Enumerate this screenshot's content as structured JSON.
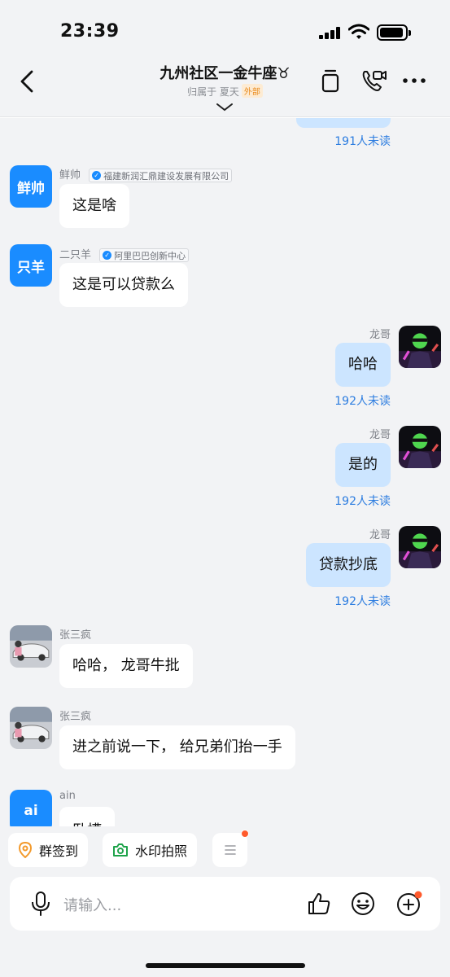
{
  "status_bar": {
    "time": "23:39"
  },
  "header": {
    "title": "九州社区一金牛座♉",
    "subtitle_prefix": "归属于 夏天",
    "subtitle_tag": "外部",
    "icons": [
      "back-icon",
      "copy-icon",
      "video-call-icon",
      "more-icon",
      "chevron-down-icon"
    ]
  },
  "messages": [
    {
      "kind": "out_partial",
      "unread": "191人未读"
    },
    {
      "kind": "in",
      "avatar_text": "鲜帅",
      "sender": "鲜帅",
      "org": "福建新润汇鼎建设发展有限公司",
      "text": "这是啥"
    },
    {
      "kind": "in",
      "avatar_text": "只羊",
      "sender": "二只羊",
      "org": "阿里巴巴创新中心",
      "text": "这是可以贷款么"
    },
    {
      "kind": "out",
      "sender": "龙哥",
      "text": "哈哈",
      "unread": "192人未读"
    },
    {
      "kind": "out",
      "sender": "龙哥",
      "text": "是的",
      "unread": "192人未读"
    },
    {
      "kind": "out",
      "sender": "龙哥",
      "text": "贷款抄底",
      "unread": "192人未读"
    },
    {
      "kind": "in",
      "sender": "张三疯",
      "text": "哈哈， 龙哥牛批"
    },
    {
      "kind": "in",
      "sender": "张三疯",
      "text": "进之前说一下， 给兄弟们抬一手"
    },
    {
      "kind": "in",
      "avatar_text": "ai",
      "sender": "ain",
      "text": "卧槽"
    }
  ],
  "quick_actions": [
    {
      "label": "群签到",
      "icon": "location-pin-icon"
    },
    {
      "label": "水印拍照",
      "icon": "camera-icon"
    },
    {
      "label": "",
      "icon": "menu-icon",
      "badge": true
    }
  ],
  "composer": {
    "placeholder": "请输入...",
    "icons": [
      "microphone-icon",
      "thumbs-up-icon",
      "emoji-icon",
      "plus-icon"
    ]
  },
  "colors": {
    "accent": "#1a8cff",
    "out_bubble": "#cce5ff",
    "in_bubble": "#ffffff",
    "unread_text": "#2d7de0",
    "background": "#f2f3f5",
    "external_tag": "#e98a1c",
    "badge": "#ff5a2c"
  }
}
